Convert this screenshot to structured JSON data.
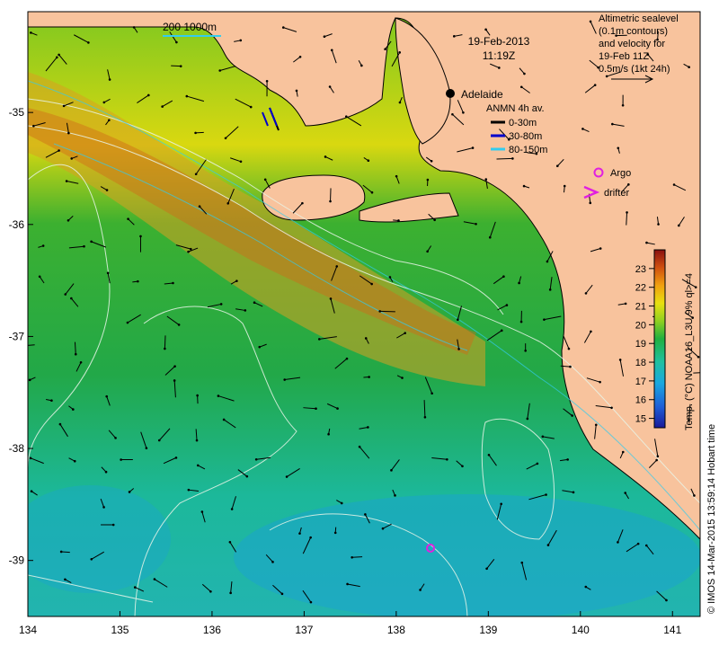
{
  "map": {
    "title_date": "19-Feb-2013",
    "title_time": "11:19Z",
    "scale_bar_label": "200  1000m",
    "city": "Adelaide",
    "altimetry": {
      "lines": [
        "Altimetric sealevel",
        "(0.1m contours)",
        "and velocity for",
        "19-Feb 11Z",
        "0.5m/s (1kt 24h)"
      ]
    },
    "anmn": {
      "title": "ANMN 4h av.",
      "items": [
        {
          "label": "0-30m",
          "color": "#000000"
        },
        {
          "label": "30-80m",
          "color": "#0000cc"
        },
        {
          "label": "80-150m",
          "color": "#33ccee"
        }
      ]
    },
    "markers": {
      "argo": {
        "label": "Argo",
        "color": "#e020e0"
      },
      "drifter": {
        "label": "drifter",
        "color": "#e020e0"
      }
    },
    "colorbar": {
      "title": "Temp. (°C) NOAA16_L3U 9% ql>=4",
      "min": 14.5,
      "max": 24,
      "ticks": [
        "15",
        "16",
        "17",
        "18",
        "19",
        "20",
        "21",
        "22",
        "23"
      ]
    },
    "credit": "© IMOS 14-Mar-2015 13:59:14 Hobart time",
    "lon_ticks": [
      "134",
      "135",
      "136",
      "137",
      "138",
      "139",
      "140",
      "141"
    ],
    "lat_ticks": [
      "-35",
      "-36",
      "-37",
      "-38",
      "-39"
    ],
    "lon_range": [
      134,
      141.3
    ],
    "lat_range": [
      -34.1,
      -39.5
    ]
  }
}
